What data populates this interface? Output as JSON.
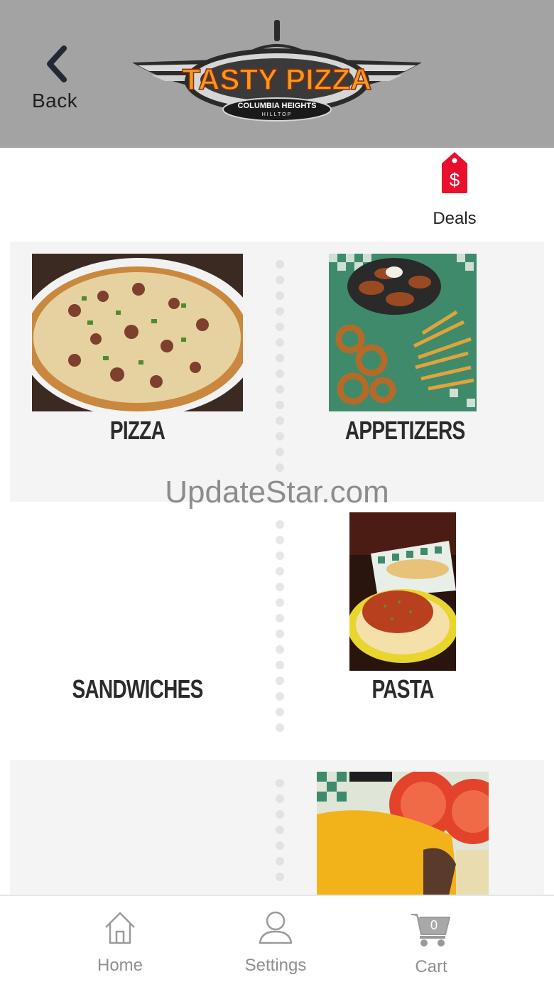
{
  "header": {
    "back_label": "Back",
    "logo_title": "TASTY PIZZA",
    "logo_subtitle": "COLUMBIA HEIGHTS",
    "logo_sub2": "HILLTOP"
  },
  "deals": {
    "label": "Deals",
    "icon": "price-tag-icon",
    "color": "#e8112d"
  },
  "categories": [
    {
      "name": "PIZZA"
    },
    {
      "name": "APPETIZERS"
    },
    {
      "name": "SANDWICHES"
    },
    {
      "name": "PASTA"
    }
  ],
  "watermark": "UpdateStar.com",
  "tabbar": {
    "home": "Home",
    "settings": "Settings",
    "cart": "Cart",
    "cart_count": "0"
  }
}
